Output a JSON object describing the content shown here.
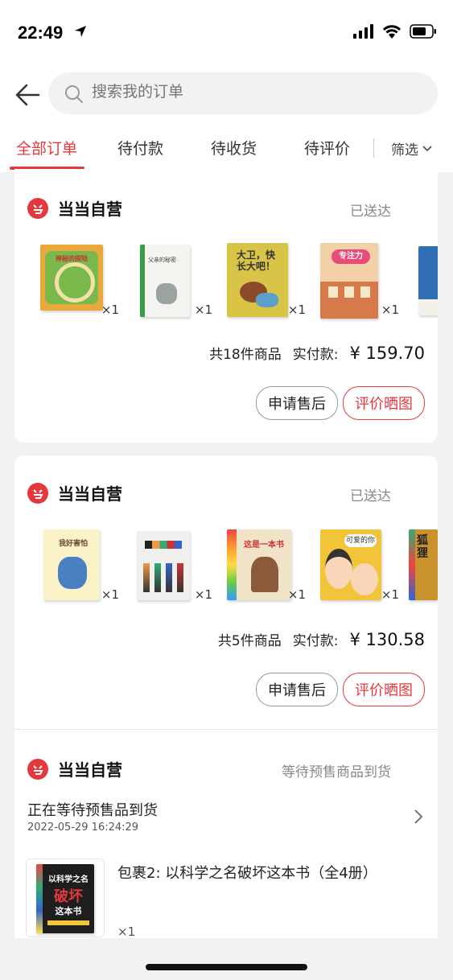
{
  "status_bar": {
    "time": "22:49"
  },
  "search": {
    "placeholder": "搜索我的订单"
  },
  "tabs": [
    {
      "label": "全部订单",
      "active": true
    },
    {
      "label": "待付款"
    },
    {
      "label": "待收货"
    },
    {
      "label": "待评价"
    }
  ],
  "filter_label": "筛选",
  "orders": [
    {
      "shop": "当当自营",
      "status": "已送达",
      "items": [
        {
          "qty": "×1",
          "cover_color": "#e8a83a",
          "title_text": "神秘的探险"
        },
        {
          "qty": "×1",
          "cover_color": "#f4f4f0",
          "title_text": "父亲的秘密"
        },
        {
          "qty": "×1",
          "cover_color": "#d9c447",
          "title_text": "大卫，快长大吧！"
        },
        {
          "qty": "×1",
          "cover_color": "#f3d0a8",
          "title_text": "专注力"
        },
        {
          "qty": "",
          "cover_color": "#2f6db5",
          "title_text": ""
        }
      ],
      "count_text": "共18件商品",
      "paid_label": "实付款:",
      "paid_amount": "¥ 159.70",
      "after_sale_button": "申请售后",
      "review_button": "评价晒图"
    },
    {
      "shop": "当当自营",
      "status": "已送达",
      "items": [
        {
          "qty": "×1",
          "cover_color": "#faf2c8",
          "title_text": "我好害怕"
        },
        {
          "qty": "×1",
          "cover_color": "#f0f0ee",
          "title_text": ""
        },
        {
          "qty": "×1",
          "cover_color": "#f1e3c8",
          "title_text": "这是一本书"
        },
        {
          "qty": "×1",
          "cover_color": "#f2c43a",
          "title_text": "可爱的你"
        },
        {
          "qty": "",
          "cover_color": "#c9922c",
          "title_text": "狐狸"
        }
      ],
      "count_text": "共5件商品",
      "paid_label": "实付款:",
      "paid_amount": "¥ 130.58",
      "after_sale_button": "申请售后",
      "review_button": "评价晒图"
    },
    {
      "shop": "当当自营",
      "status": "等待预售商品到货",
      "wait_title": "正在等待预售品到货",
      "wait_time": "2022-05-29 16:24:29",
      "package_title": "包裹2: 以科学之名破坏这本书（全4册）",
      "qty": "×1",
      "cover_lines": [
        "以科学之名",
        "破坏",
        "这本书"
      ]
    }
  ],
  "colors": {
    "accent": "#e4393c",
    "background": "#f2f2f2"
  }
}
